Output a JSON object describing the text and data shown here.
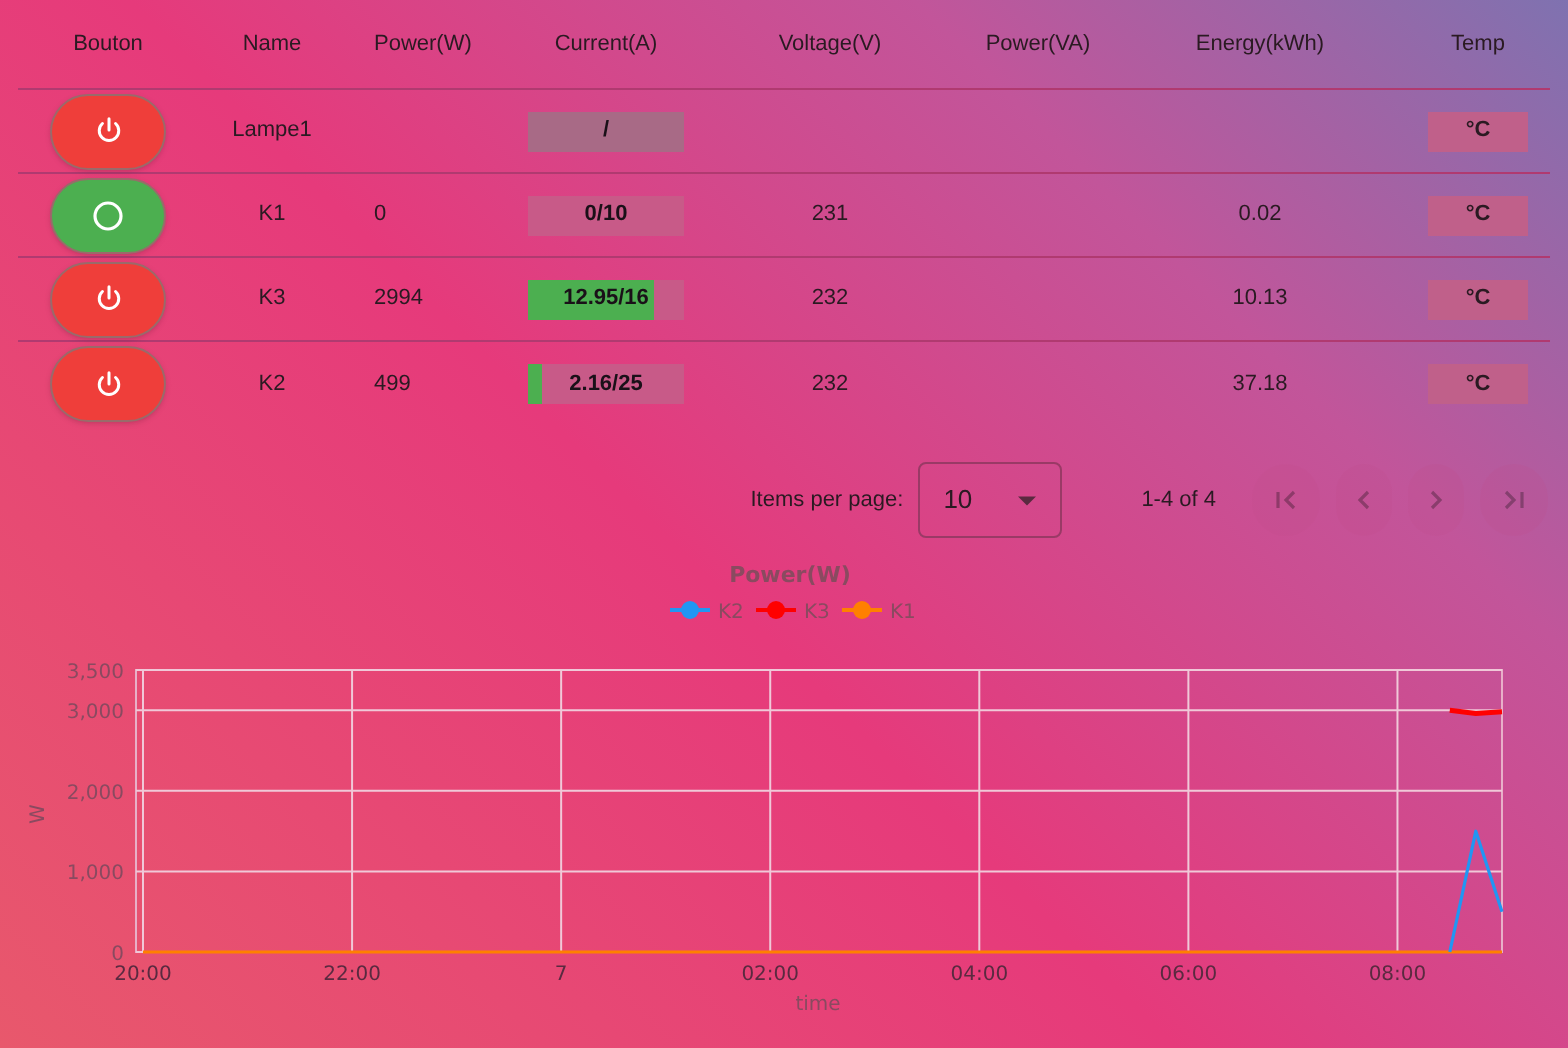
{
  "table": {
    "columns": [
      "Bouton",
      "Name",
      "Power(W)",
      "Current(A)",
      "Voltage(V)",
      "Power(VA)",
      "Energy(kWh)",
      "Temp"
    ],
    "rows": [
      {
        "on": false,
        "name": "Lampe1",
        "power": "",
        "current": "/",
        "level": 0,
        "voltage": "",
        "power_va": "",
        "energy": "",
        "temp": "°C"
      },
      {
        "on": true,
        "name": "K1",
        "power": "0",
        "current": "0/10",
        "level": 0,
        "voltage": "231",
        "power_va": "",
        "energy": "0.02",
        "temp": "°C"
      },
      {
        "on": false,
        "name": "K3",
        "power": "2994",
        "current": "12.95/16",
        "level": 0.81,
        "voltage": "232",
        "power_va": "",
        "energy": "10.13",
        "temp": "°C"
      },
      {
        "on": false,
        "name": "K2",
        "power": "499",
        "current": "2.16/25",
        "level": 0.086,
        "voltage": "232",
        "power_va": "",
        "energy": "37.18",
        "temp": "°C"
      }
    ]
  },
  "paginator": {
    "label": "Items per page:",
    "page_size": "10",
    "range": "1-4 of 4",
    "first_disabled": true,
    "prev_disabled": true,
    "next_disabled": true,
    "last_disabled": true
  },
  "chart_data": {
    "type": "line",
    "title": "Power(W)",
    "xlabel": "time",
    "ylabel": "W",
    "categories": [
      "20:00",
      null,
      null,
      null,
      null,
      null,
      null,
      null,
      "22:00",
      null,
      null,
      null,
      null,
      null,
      null,
      null,
      "7",
      null,
      null,
      null,
      null,
      null,
      null,
      null,
      "02:00",
      null,
      null,
      null,
      null,
      null,
      null,
      null,
      "04:00",
      null,
      null,
      null,
      null,
      null,
      null,
      null,
      "06:00",
      null,
      null,
      null,
      null,
      null,
      null,
      null,
      "08:00",
      null,
      null,
      null,
      null
    ],
    "series": [
      {
        "name": "K2",
        "color": "#2196f3",
        "values": [
          null,
          null,
          null,
          null,
          null,
          null,
          null,
          null,
          null,
          null,
          null,
          null,
          null,
          null,
          null,
          null,
          null,
          null,
          null,
          null,
          null,
          null,
          null,
          null,
          null,
          null,
          null,
          null,
          null,
          null,
          null,
          null,
          null,
          null,
          null,
          null,
          null,
          null,
          null,
          null,
          null,
          null,
          null,
          null,
          null,
          null,
          null,
          null,
          null,
          null,
          0,
          1500,
          500
        ]
      },
      {
        "name": "K3",
        "color": "#ff0000",
        "values": [
          null,
          null,
          null,
          null,
          null,
          null,
          null,
          null,
          null,
          null,
          null,
          null,
          null,
          null,
          null,
          null,
          null,
          null,
          null,
          null,
          null,
          null,
          null,
          null,
          null,
          null,
          null,
          null,
          null,
          null,
          null,
          null,
          null,
          null,
          null,
          null,
          null,
          null,
          null,
          null,
          null,
          null,
          null,
          null,
          null,
          null,
          null,
          null,
          null,
          null,
          3000,
          2960,
          2980
        ]
      },
      {
        "name": "K1",
        "color": "#ff8000",
        "values": [
          0,
          0,
          0,
          0,
          0,
          0,
          0,
          0,
          0,
          0,
          0,
          0,
          0,
          0,
          0,
          0,
          0,
          0,
          0,
          0,
          0,
          0,
          0,
          0,
          0,
          0,
          0,
          0,
          0,
          0,
          0,
          0,
          0,
          0,
          0,
          0,
          0,
          0,
          0,
          0,
          0,
          0,
          0,
          0,
          0,
          0,
          0,
          0,
          0,
          0,
          0,
          0,
          0
        ]
      }
    ],
    "ylim": [
      0,
      3500
    ],
    "grid": true,
    "legend": true,
    "yticks": [
      {
        "value": 0,
        "label": "0"
      },
      {
        "value": 1000,
        "label": "1,000"
      },
      {
        "value": 2000,
        "label": "2,000"
      },
      {
        "value": 3000,
        "label": "3,000"
      },
      {
        "value": 3500,
        "label": "3,500"
      }
    ]
  }
}
